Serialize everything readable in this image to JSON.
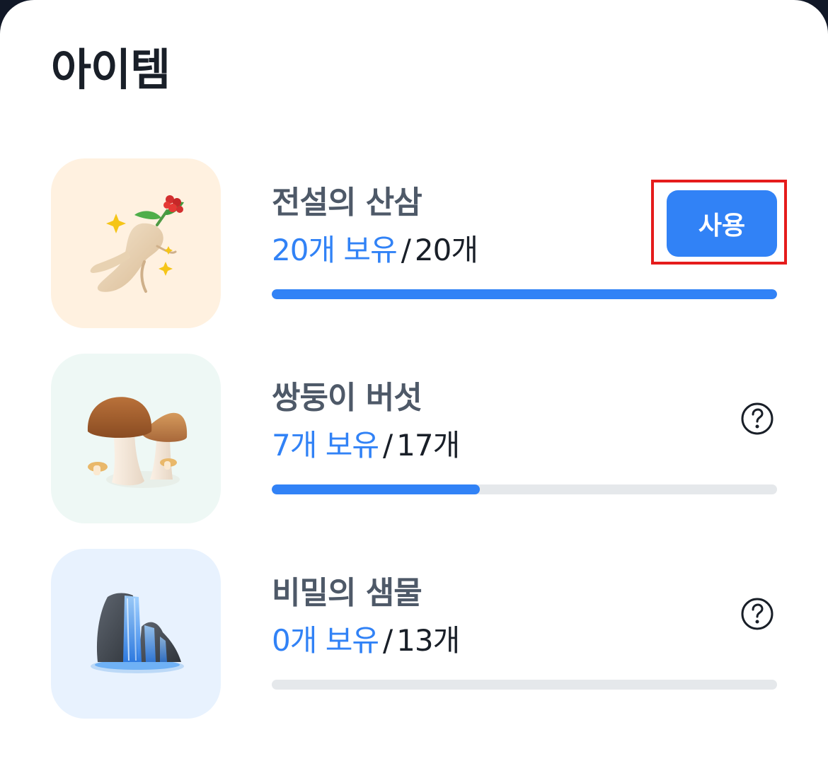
{
  "header": {
    "title": "아이템"
  },
  "items": [
    {
      "name": "전설의 산삼",
      "owned_label": "20개 보유",
      "separator": "/",
      "total_label": "20개",
      "progress": 1.0,
      "thumb_bg": "#fff1e0",
      "icon": "ginseng-icon",
      "action": {
        "type": "button",
        "label": "사용"
      }
    },
    {
      "name": "쌍둥이 버섯",
      "owned_label": "7개 보유",
      "separator": "/",
      "total_label": "17개",
      "progress": 0.412,
      "thumb_bg": "#eef8f5",
      "icon": "mushroom-icon",
      "action": {
        "type": "help",
        "icon": "question-circle-icon"
      }
    },
    {
      "name": "비밀의 샘물",
      "owned_label": "0개 보유",
      "separator": "/",
      "total_label": "13개",
      "progress": 0.0,
      "thumb_bg": "#e8f2fe",
      "icon": "waterfall-icon",
      "action": {
        "type": "help",
        "icon": "question-circle-icon"
      }
    }
  ],
  "colors": {
    "accent": "#3182f6",
    "track": "#e5e8eb",
    "text_primary": "#191f28",
    "text_secondary": "#4e5968",
    "highlight": "#e51c1c"
  }
}
